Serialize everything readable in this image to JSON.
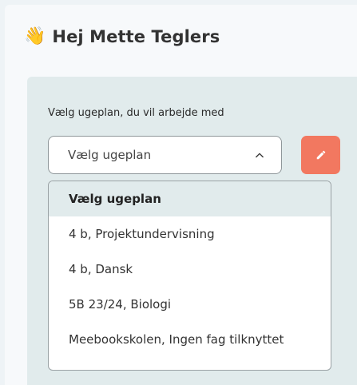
{
  "greeting": {
    "emoji": "👋",
    "text": "Hej Mette Teglers"
  },
  "plan_selector": {
    "label": "Vælg ugeplan, du vil arbejde med",
    "selected_value": "Vælg ugeplan",
    "expanded": true,
    "options": [
      {
        "label": "Vælg ugeplan",
        "selected": true
      },
      {
        "label": "4 b, Projektundervisning",
        "selected": false
      },
      {
        "label": "4 b, Dansk",
        "selected": false
      },
      {
        "label": "5B 23/24, Biologi",
        "selected": false
      },
      {
        "label": "Meebookskolen, Ingen fag tilknyttet",
        "selected": false
      }
    ]
  },
  "edit_button": {
    "icon": "pencil-icon",
    "color": "#f27860"
  },
  "colors": {
    "panel_background": "#e1ebec",
    "accent": "#f27860"
  }
}
